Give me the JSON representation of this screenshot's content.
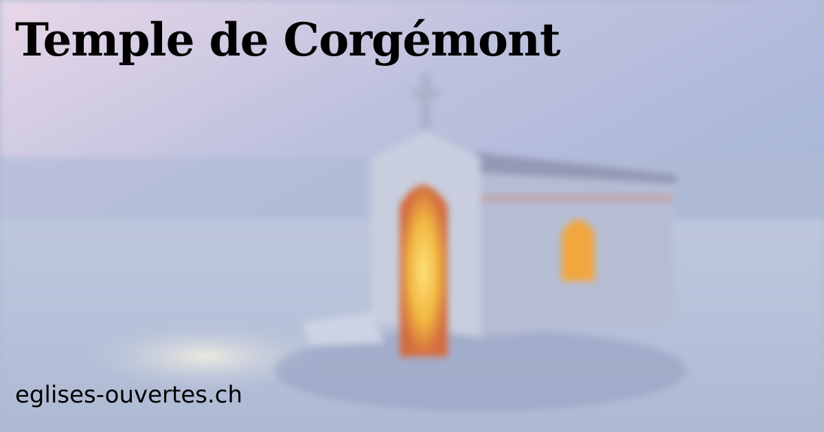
{
  "card": {
    "title": "Temple de Corgémont",
    "site": "eglises-ouvertes.ch"
  },
  "background": {
    "subject": "chapel-in-snow-illustration",
    "colors": {
      "sky_top": "#c8c0dc",
      "sky_bottom": "#9aaccc",
      "snow": "#c4cde0",
      "chapel_wall": "#b8c0d4",
      "door_glow": "#f0c040",
      "window_glow": "#e89030"
    }
  }
}
